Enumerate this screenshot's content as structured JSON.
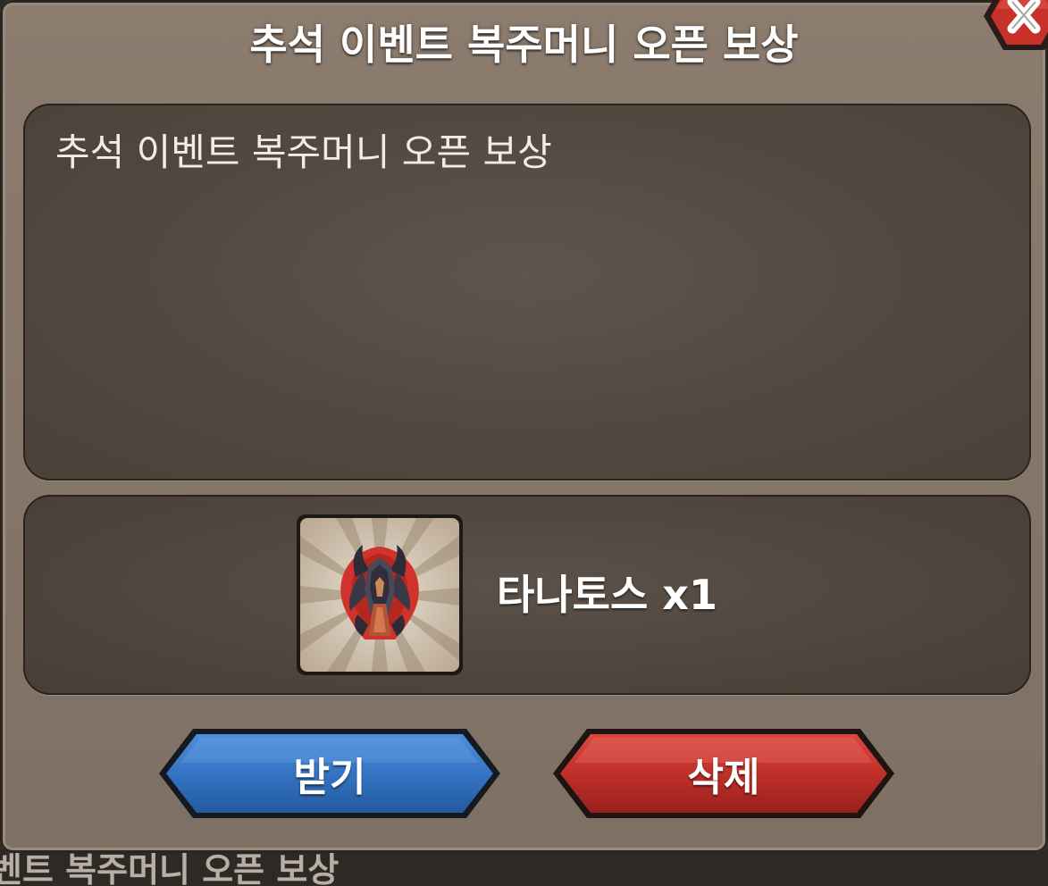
{
  "dialog": {
    "title": "추석 이벤트 복주머니 오픈 보상",
    "message": "추석 이벤트 복주머니 오픈 보상"
  },
  "reward": {
    "item_icon": "thanatos-emblem-icon",
    "label": "타나토스 x1"
  },
  "buttons": {
    "receive_label": "받기",
    "delete_label": "삭제",
    "receive_color": "#2f6fc0",
    "delete_color": "#c0302a"
  },
  "close": {
    "icon": "close-icon"
  },
  "background": {
    "partial_text": "벤트 복주머니 오픈 보상"
  }
}
